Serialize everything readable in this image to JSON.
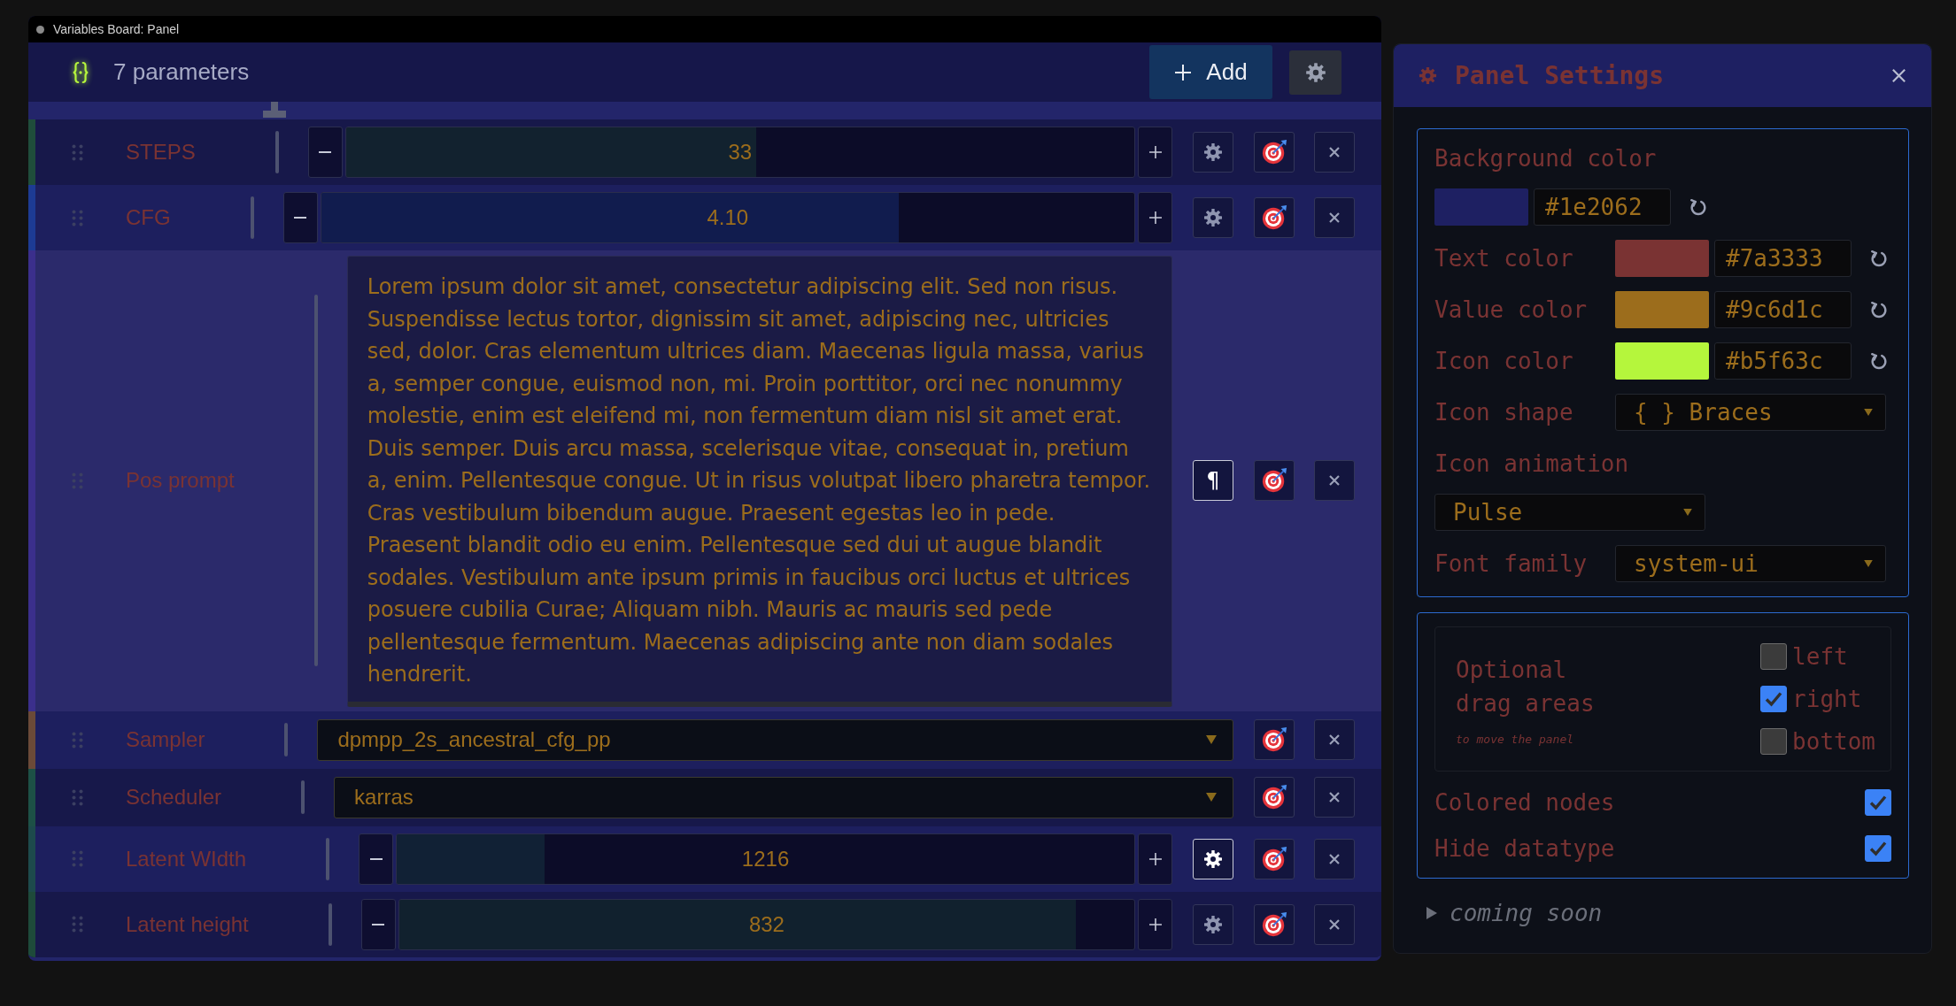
{
  "window": {
    "title": "Variables Board: Panel"
  },
  "header": {
    "count_label": "7 parameters",
    "add_label": "Add"
  },
  "parameters": [
    {
      "kind": "number",
      "name": "STEPS",
      "color": "#1f4d3b",
      "selected": false,
      "value": "33",
      "level": 0.52,
      "options_active": false
    },
    {
      "kind": "number",
      "name": "CFG",
      "color": "#1d3b94",
      "selected": false,
      "value": "4.10",
      "level": 0.71,
      "options_active": false
    },
    {
      "kind": "text",
      "name": "Pos prompt",
      "color": "#3b2f8c",
      "selected": true,
      "value": "Lorem ipsum dolor sit amet, consectetur adipiscing elit. Sed non risus. Suspendisse lectus tortor, dignissim sit amet, adipiscing nec, ultricies sed, dolor. Cras elementum ultrices diam. Maecenas ligula massa, varius a, semper congue, euismod non, mi. Proin porttitor, orci nec nonummy molestie, enim est eleifend mi, non fermentum diam nisl sit amet erat. Duis semper. Duis arcu massa, scelerisque vitae, consequat in, pretium a, enim. Pellentesque congue. Ut in risus volutpat libero pharetra tempor. Cras vestibulum bibendum augue. Praesent egestas leo in pede. Praesent blandit odio eu enim. Pellentesque sed dui ut augue blandit sodales. Vestibulum ante ipsum primis in faucibus orci luctus et ultrices posuere cubilia Curae; Aliquam nibh. Mauris ac mauris sed pede pellentesque fermentum. Maecenas adipiscing ante non diam sodales hendrerit.",
      "format_glyph": "¶",
      "options_active": true
    },
    {
      "kind": "select",
      "name": "Sampler",
      "color": "#6b4a38",
      "selected": false,
      "value": "dpmpp_2s_ancestral_cfg_pp"
    },
    {
      "kind": "select",
      "name": "Scheduler",
      "color": "#1d5046",
      "selected": false,
      "value": "karras"
    },
    {
      "kind": "number",
      "name": "Latent WIdth",
      "color": "#1d4a4c",
      "selected": false,
      "value": "1216",
      "level": 0.2,
      "options_active": true
    },
    {
      "kind": "number",
      "name": "Latent height",
      "color": "#1e4a3a",
      "selected": false,
      "value": "832",
      "level": 0.92,
      "options_active": false
    }
  ],
  "settings_panel": {
    "title": "Panel Settings",
    "colors": [
      {
        "label": "Background color",
        "value": "#1e2062",
        "color": "#1e2062"
      },
      {
        "label": "Text color",
        "value": "#7a3333",
        "color": "#7a3333"
      },
      {
        "label": "Value color",
        "value": "#9c6d1c",
        "color": "#9c6d1c"
      },
      {
        "label": "Icon color",
        "value": "#b5f63c",
        "color": "#b5f63c"
      }
    ],
    "selects": [
      {
        "label": "Icon shape",
        "value": "{ } Braces"
      },
      {
        "label": "Icon animation",
        "value": "Pulse"
      },
      {
        "label": "Font family",
        "value": "system-ui"
      }
    ],
    "drag_areas": {
      "title": "Optional drag areas",
      "hint": "to move the panel",
      "options": [
        {
          "label": "left",
          "checked": false
        },
        {
          "label": "right",
          "checked": true
        },
        {
          "label": "bottom",
          "checked": false
        }
      ]
    },
    "toggles": [
      {
        "label": "Colored nodes",
        "checked": true
      },
      {
        "label": "Hide datatype",
        "checked": true
      }
    ],
    "coming_soon": {
      "label": "coming soon",
      "expanded": false
    }
  }
}
